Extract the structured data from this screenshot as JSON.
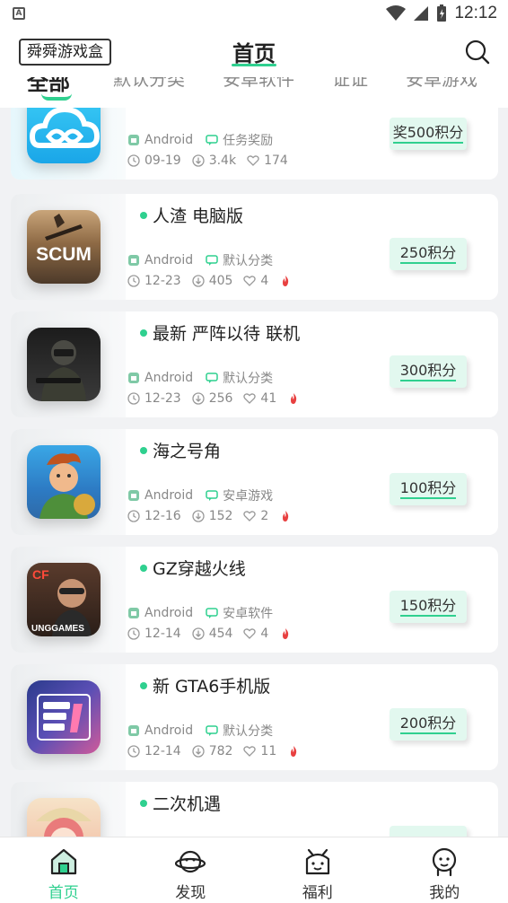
{
  "status_bar": {
    "time": "12:12"
  },
  "header": {
    "brand": "舜舜游戏盒",
    "title": "首页"
  },
  "tabs": [
    "全部",
    "默认分类",
    "安卓软件",
    "证证",
    "安卓游戏"
  ],
  "apps": [
    {
      "name": "",
      "platform": "Android",
      "category": "任务奖励",
      "date": "09-19",
      "downloads": "3.4k",
      "likes": "174",
      "points": "奖500积分",
      "hot": false
    },
    {
      "name": "人渣 电脑版",
      "platform": "Android",
      "category": "默认分类",
      "date": "12-23",
      "downloads": "405",
      "likes": "4",
      "points": "250积分",
      "hot": true
    },
    {
      "name": "最新 严阵以待 联机",
      "platform": "Android",
      "category": "默认分类",
      "date": "12-23",
      "downloads": "256",
      "likes": "41",
      "points": "300积分",
      "hot": true
    },
    {
      "name": "海之号角",
      "platform": "Android",
      "category": "安卓游戏",
      "date": "12-16",
      "downloads": "152",
      "likes": "2",
      "points": "100积分",
      "hot": true
    },
    {
      "name": "GZ穿越火线",
      "platform": "Android",
      "category": "安卓软件",
      "date": "12-14",
      "downloads": "454",
      "likes": "4",
      "points": "150积分",
      "hot": true
    },
    {
      "name": "新 GTA6手机版",
      "platform": "Android",
      "category": "默认分类",
      "date": "12-14",
      "downloads": "782",
      "likes": "11",
      "points": "200积分",
      "hot": true
    },
    {
      "name": "二次机遇",
      "platform": "",
      "category": "",
      "date": "",
      "downloads": "",
      "likes": "",
      "points": "",
      "hot": false
    }
  ],
  "icon_labels": {
    "scum": "SCUM",
    "cf": "CF",
    "ung": "UNGGAMES"
  },
  "bottom_nav": [
    {
      "label": "首页",
      "icon": "home-icon",
      "active": true
    },
    {
      "label": "发现",
      "icon": "planet-icon",
      "active": false
    },
    {
      "label": "福利",
      "icon": "gift-icon",
      "active": false
    },
    {
      "label": "我的",
      "icon": "profile-icon",
      "active": false
    }
  ],
  "colors": {
    "accent": "#2fd08f",
    "points_bg": "#e2f8ef",
    "hot": "#e84040"
  }
}
